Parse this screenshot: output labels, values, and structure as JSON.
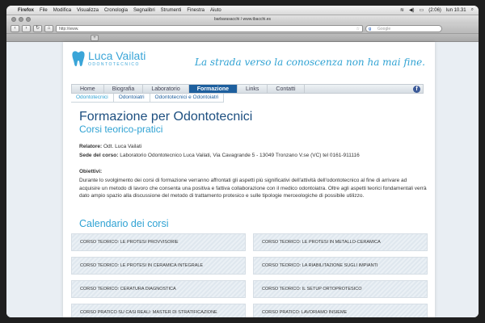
{
  "menubar": {
    "app": "Firefox",
    "items": [
      "File",
      "Modifica",
      "Visualizza",
      "Cronologia",
      "Segnalibri",
      "Strumenti",
      "Finestra",
      "Aiuto"
    ],
    "battery": "(2:06)",
    "clock": "lun 10.31"
  },
  "window": {
    "title": "barbarasacchi / www.tbacchi.es",
    "url": "http://www.",
    "search_placeholder": "Google"
  },
  "site": {
    "logo_name": "Luca Vailati",
    "logo_sub": "ODONTOTECNICO",
    "tagline": "La strada verso la conoscenza non ha mai fine.",
    "nav": [
      "Home",
      "Biografia",
      "Laboratorio",
      "Formazione",
      "Links",
      "Contatti"
    ],
    "nav_active": "Formazione",
    "subnav": [
      "Odontotecnici",
      "Odontoiatri",
      "Odontotecnici e Odontoiatri"
    ],
    "title": "Formazione per Odontotecnici",
    "subtitle": "Corsi teorico-pratici",
    "relatore_label": "Relatore:",
    "relatore_value": "Odt. Luca Vailati",
    "sede_label": "Sede del corso:",
    "sede_value": "Laboratorio Odontotecnico Luca Vailati, Via Cavagrande 5 - 13049 Tronzano V.se (VC) tel 0161-911116",
    "obiettivi_label": "Obiettivi:",
    "obiettivi_text": "Durante lo svolgimento dei corsi di formazione verranno affrontati gli aspetti più significativi dell'attività dell'odontotecnico al fine di arrivare ad acquisire un metodo di lavoro che consenta una positiva e fattiva collaborazione con il medico odontoiatra. Oltre agli aspetti teorici fondamentali verrà dato ampio spazio alla discussione del metodo di trattamento protesico e sulle tipologie merceologiche di possibile utilizzo.",
    "calendar_title": "Calendario dei corsi",
    "courses": [
      "CORSO TEORICO: LE PROTESI PROVVISORIE",
      "CORSO TEORICO: LE PROTESI IN METALLO-CERAMICA",
      "CORSO TEORICO: LE PROTESI IN CERAMICA INTEGRALE",
      "CORSO TEORICO: LA RIABILITAZIONE SUGLI IMPIANTI",
      "CORSO TEORICO: CERATURA DIAGNOSTICA",
      "CORSO TEORICO: IL SETUP ORTOPROTESICO",
      "CORSO PRATICO SU CASI REALI: MASTER DI STRATIFICAZIONE",
      "CORSO PRATICO: LAVORIAMO INSIEME"
    ]
  }
}
